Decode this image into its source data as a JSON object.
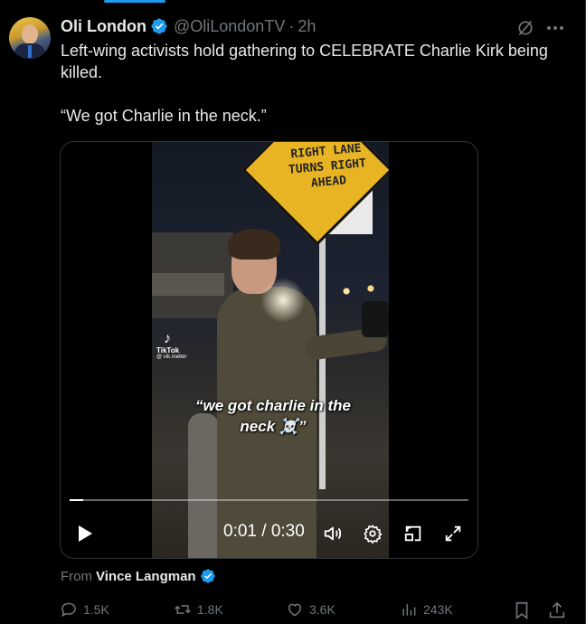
{
  "author": {
    "name": "Oli London",
    "handle": "@OliLondonTV",
    "separator": "·",
    "time": "2h"
  },
  "tweet": {
    "line1": "Left-wing activists hold gathering to CELEBRATE Charlie Kirk being killed.",
    "line2": "“We got Charlie in the neck.”"
  },
  "video": {
    "sign_lines": [
      "RIGHT LANE",
      "TURNS RIGHT",
      "AHEAD"
    ],
    "watermark": "TikTok",
    "watermark_handle": "@ vik.melter",
    "caption_line1": "“we got charlie in the",
    "caption_line2": "neck ☠️”",
    "timecode": "0:01 / 0:30",
    "progress": 0.033
  },
  "source": {
    "prefix": "From",
    "name": "Vince Langman"
  },
  "actions": {
    "replies": "1.5K",
    "reposts": "1.8K",
    "likes": "3.6K",
    "views": "243K"
  },
  "colors": {
    "accent": "#1d9bf0",
    "muted": "#71767b",
    "text": "#e7e9ea",
    "background": "#000000"
  },
  "icons": [
    "verified-icon",
    "grok-icon",
    "more-icon",
    "play-icon",
    "volume-icon",
    "settings-icon",
    "pip-icon",
    "fullscreen-icon",
    "reply-icon",
    "repost-icon",
    "like-icon",
    "views-icon",
    "bookmark-icon",
    "share-icon"
  ]
}
